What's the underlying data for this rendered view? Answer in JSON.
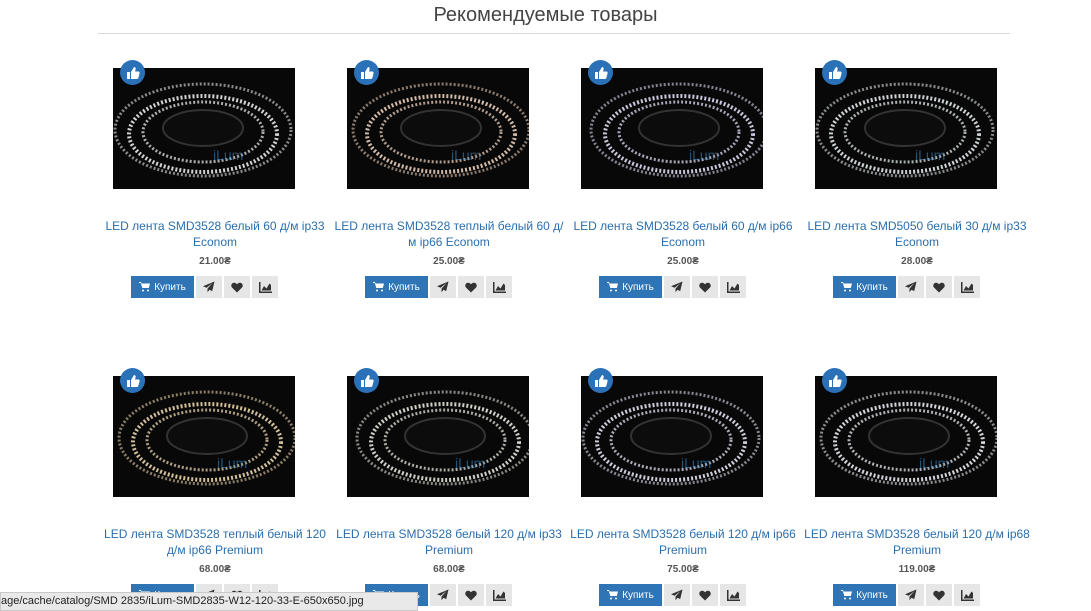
{
  "section_title": "Рекомендуемые товары",
  "buy_label": "Купить",
  "products": [
    {
      "name": "LED лента SMD3528 белый 60 д/м ip33 Econom",
      "price": "21.00₴",
      "glow": "#f4f4f4"
    },
    {
      "name": "LED лента SMD3528 теплый белый 60 д/м ip66 Econom",
      "price": "25.00₴",
      "glow": "#f6d9c3"
    },
    {
      "name": "LED лента SMD3528 белый 60 д/м ip66 Econom",
      "price": "25.00₴",
      "glow": "#ece6ff"
    },
    {
      "name": "LED лента SMD5050 белый 30 д/м ip33 Econom",
      "price": "28.00₴",
      "glow": "#f0f6f8"
    },
    {
      "name": "LED лента SMD3528 теплый белый 120 д/м ip66 Premium",
      "price": "68.00₴",
      "glow": "#f5dfb4"
    },
    {
      "name": "LED лента SMD3528 белый 120 д/м ip33 Premium",
      "price": "68.00₴",
      "glow": "#f2f2ea"
    },
    {
      "name": "LED лента SMD3528 белый 120 д/м ip66 Premium",
      "price": "75.00₴",
      "glow": "#eef0ff"
    },
    {
      "name": "LED лента SMD3528 белый 120 д/м ip68 Premium",
      "price": "119.00₴",
      "glow": "#f6f8ff"
    }
  ],
  "status_url": "age/cache/catalog/SMD 2835/iLum-SMD2835-W12-120-33-E-650x650.jpg",
  "colors": {
    "accent": "#2f74b5",
    "link": "#2a6ead",
    "badge": "#2a71b8"
  }
}
